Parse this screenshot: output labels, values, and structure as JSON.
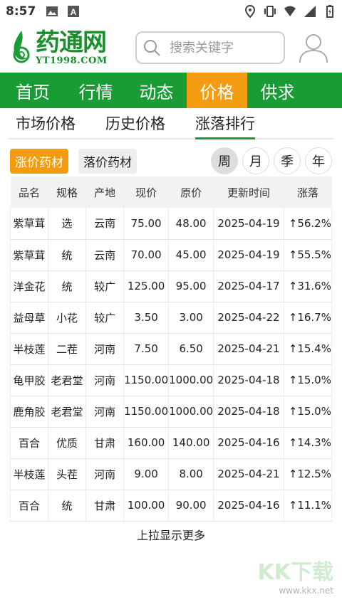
{
  "status_bar": {
    "time": "8:57"
  },
  "header": {
    "logo_cn": "药通网",
    "logo_en": "YT1998.COM",
    "search_placeholder": "搜索关键字"
  },
  "nav": {
    "items": [
      "首页",
      "行情",
      "动态",
      "价格",
      "供求"
    ],
    "active_index": 3
  },
  "subtabs": {
    "items": [
      "市场价格",
      "历史价格",
      "涨落排行"
    ],
    "active_index": 2
  },
  "filters": {
    "up_label": "涨价药材",
    "down_label": "落价药材",
    "periods": [
      "周",
      "月",
      "季",
      "年"
    ],
    "active_period": 0
  },
  "table": {
    "headers": [
      "品名",
      "规格",
      "产地",
      "现价",
      "原价",
      "更新时间",
      "涨落"
    ],
    "rows": [
      [
        "紫草茸",
        "选",
        "云南",
        "75.00",
        "48.00",
        "2025-04-19",
        "↑56.2%"
      ],
      [
        "紫草茸",
        "统",
        "云南",
        "70.00",
        "45.00",
        "2025-04-19",
        "↑55.5%"
      ],
      [
        "洋金花",
        "统",
        "较广",
        "125.00",
        "95.00",
        "2025-04-17",
        "↑31.6%"
      ],
      [
        "益母草",
        "小花",
        "较广",
        "3.50",
        "3.00",
        "2025-04-22",
        "↑16.7%"
      ],
      [
        "半枝莲",
        "二茬",
        "河南",
        "7.50",
        "6.50",
        "2025-04-21",
        "↑15.4%"
      ],
      [
        "龟甲胶",
        "老君堂",
        "河南",
        "1150.00",
        "1000.00",
        "2025-04-18",
        "↑15.0%"
      ],
      [
        "鹿角胶",
        "老君堂",
        "河南",
        "1150.00",
        "1000.00",
        "2025-04-18",
        "↑15.0%"
      ],
      [
        "百合",
        "优质",
        "甘肃",
        "160.00",
        "140.00",
        "2025-04-16",
        "↑14.3%"
      ],
      [
        "半枝莲",
        "头茬",
        "河南",
        "9.00",
        "8.00",
        "2025-04-21",
        "↑12.5%"
      ],
      [
        "百合",
        "统",
        "甘肃",
        "100.00",
        "90.00",
        "2025-04-16",
        "↑11.1%"
      ]
    ]
  },
  "footer": {
    "load_more": "上拉显示更多"
  },
  "watermark": {
    "text": "KK下载",
    "url": "www.kkx.net"
  },
  "colors": {
    "brand_green": "#1a9c35",
    "accent_orange": "#f39c12"
  }
}
